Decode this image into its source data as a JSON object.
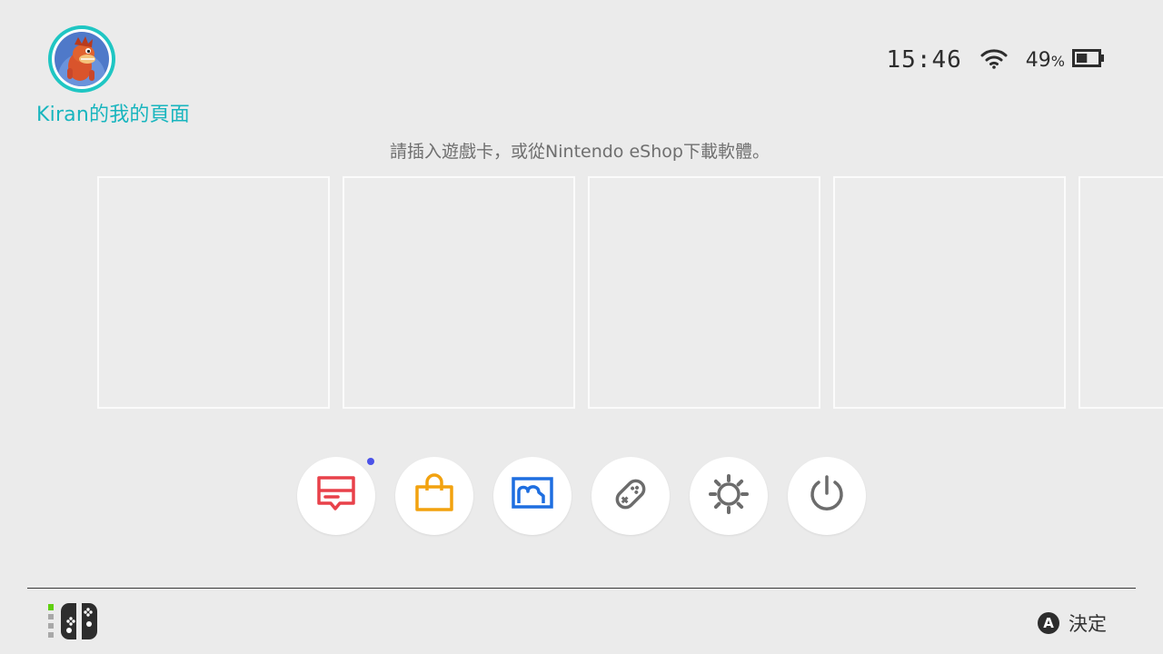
{
  "user": {
    "profile_name": "Kiran的我的頁面"
  },
  "status": {
    "time": "15:46",
    "battery_value": "49",
    "battery_unit": "%",
    "battery_level": 0.49
  },
  "home": {
    "hint": "請插入遊戲卡，或從Nintendo eShop下載軟體。",
    "empty_tiles": 5
  },
  "apps": [
    {
      "name": "news",
      "icon": "news-icon",
      "color": "#e8414a"
    },
    {
      "name": "eshop",
      "icon": "shopping-bag-icon",
      "color": "#f2a20f"
    },
    {
      "name": "album",
      "icon": "album-icon",
      "color": "#1e6ee0"
    },
    {
      "name": "controllers",
      "icon": "controller-icon",
      "color": "#6c6c6c"
    },
    {
      "name": "system-settings",
      "icon": "gear-icon",
      "color": "#6c6c6c"
    },
    {
      "name": "sleep-mode",
      "icon": "power-icon",
      "color": "#6c6c6c"
    }
  ],
  "colors": {
    "accent": "#18b5be",
    "notification": "#4b52e8",
    "background": "#ebebeb"
  },
  "footer": {
    "a_button": "A",
    "confirm_label": "決定"
  }
}
